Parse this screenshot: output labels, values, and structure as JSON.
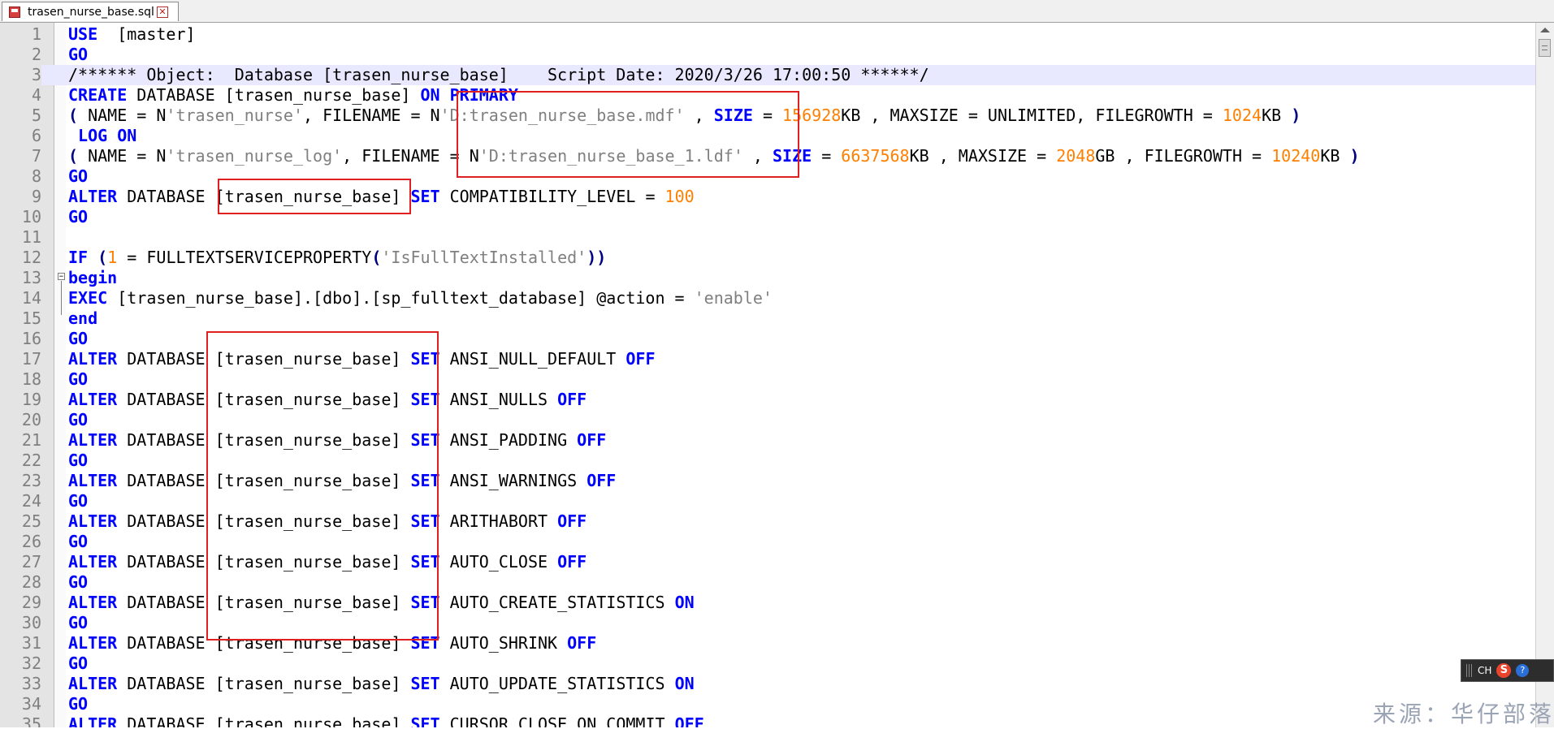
{
  "tab": {
    "label": "trasen_nurse_base.sql",
    "close_glyph": "✕",
    "icon": "sql-file-icon"
  },
  "lines": [
    {
      "n": "1",
      "t": [
        [
          "kw",
          "USE"
        ],
        [
          "",
          "  [master]"
        ]
      ]
    },
    {
      "n": "2",
      "t": [
        [
          "kw",
          "GO"
        ]
      ]
    },
    {
      "n": "3",
      "hl": true,
      "t": [
        [
          "cmt",
          "/****** Object:  Database [trasen_nurse_base]    Script Date: 2020/3/26 17:00:50 ******/"
        ]
      ]
    },
    {
      "n": "4",
      "t": [
        [
          "kw",
          "CREATE"
        ],
        [
          "",
          " DATABASE [trasen_nurse_base] "
        ],
        [
          "kw",
          "ON"
        ],
        [
          "",
          " "
        ],
        [
          "kw",
          "PRIMARY"
        ]
      ]
    },
    {
      "n": "5",
      "t": [
        [
          "op",
          "("
        ],
        [
          "",
          " NAME = N"
        ],
        [
          "str",
          "'trasen_nurse'"
        ],
        [
          "",
          ", FILENAME = N"
        ],
        [
          "str",
          "'D:trasen_nurse_base.mdf'"
        ],
        [
          "",
          " , "
        ],
        [
          "kw",
          "SIZE"
        ],
        [
          "",
          " = "
        ],
        [
          "num",
          "156928"
        ],
        [
          "",
          "KB , MAXSIZE = UNLIMITED, FILEGROWTH = "
        ],
        [
          "num",
          "1024"
        ],
        [
          "",
          "KB "
        ],
        [
          "op",
          ")"
        ]
      ]
    },
    {
      "n": "6",
      "t": [
        [
          "",
          " "
        ],
        [
          "kw",
          "LOG ON"
        ]
      ]
    },
    {
      "n": "7",
      "t": [
        [
          "op",
          "("
        ],
        [
          "",
          " NAME = N"
        ],
        [
          "str",
          "'trasen_nurse_log'"
        ],
        [
          "",
          ", FILENAME = N"
        ],
        [
          "str",
          "'D:trasen_nurse_base_1.ldf'"
        ],
        [
          "",
          " , "
        ],
        [
          "kw",
          "SIZE"
        ],
        [
          "",
          " = "
        ],
        [
          "num",
          "6637568"
        ],
        [
          "",
          "KB , MAXSIZE = "
        ],
        [
          "num",
          "2048"
        ],
        [
          "",
          "GB , FILEGROWTH = "
        ],
        [
          "num",
          "10240"
        ],
        [
          "",
          "KB "
        ],
        [
          "op",
          ")"
        ]
      ]
    },
    {
      "n": "8",
      "t": [
        [
          "kw",
          "GO"
        ]
      ]
    },
    {
      "n": "9",
      "t": [
        [
          "kw",
          "ALTER"
        ],
        [
          "",
          " DATABASE [trasen_nurse_base] "
        ],
        [
          "kw",
          "SET"
        ],
        [
          "",
          " COMPATIBILITY_LEVEL = "
        ],
        [
          "num",
          "100"
        ]
      ]
    },
    {
      "n": "10",
      "t": [
        [
          "kw",
          "GO"
        ]
      ]
    },
    {
      "n": "11",
      "t": []
    },
    {
      "n": "12",
      "t": [
        [
          "kw",
          "IF"
        ],
        [
          "",
          " "
        ],
        [
          "op",
          "("
        ],
        [
          "num",
          "1"
        ],
        [
          "",
          " = FULLTEXTSERVICEPROPERTY"
        ],
        [
          "op",
          "("
        ],
        [
          "str",
          "'IsFullTextInstalled'"
        ],
        [
          "op",
          "))"
        ]
      ]
    },
    {
      "n": "13",
      "t": [
        [
          "kw",
          "begin"
        ]
      ]
    },
    {
      "n": "14",
      "t": [
        [
          "kw",
          "EXEC"
        ],
        [
          "",
          " [trasen_nurse_base].[dbo].[sp_fulltext_database] @action = "
        ],
        [
          "str",
          "'enable'"
        ]
      ]
    },
    {
      "n": "15",
      "t": [
        [
          "kw",
          "end"
        ]
      ]
    },
    {
      "n": "16",
      "t": [
        [
          "kw",
          "GO"
        ]
      ]
    },
    {
      "n": "17",
      "t": [
        [
          "kw",
          "ALTER"
        ],
        [
          "",
          " DATABASE [trasen_nurse_base] "
        ],
        [
          "kw",
          "SET"
        ],
        [
          "",
          " ANSI_NULL_DEFAULT "
        ],
        [
          "kw",
          "OFF"
        ]
      ]
    },
    {
      "n": "18",
      "t": [
        [
          "kw",
          "GO"
        ]
      ]
    },
    {
      "n": "19",
      "t": [
        [
          "kw",
          "ALTER"
        ],
        [
          "",
          " DATABASE [trasen_nurse_base] "
        ],
        [
          "kw",
          "SET"
        ],
        [
          "",
          " ANSI_NULLS "
        ],
        [
          "kw",
          "OFF"
        ]
      ]
    },
    {
      "n": "20",
      "t": [
        [
          "kw",
          "GO"
        ]
      ]
    },
    {
      "n": "21",
      "t": [
        [
          "kw",
          "ALTER"
        ],
        [
          "",
          " DATABASE [trasen_nurse_base] "
        ],
        [
          "kw",
          "SET"
        ],
        [
          "",
          " ANSI_PADDING "
        ],
        [
          "kw",
          "OFF"
        ]
      ]
    },
    {
      "n": "22",
      "t": [
        [
          "kw",
          "GO"
        ]
      ]
    },
    {
      "n": "23",
      "t": [
        [
          "kw",
          "ALTER"
        ],
        [
          "",
          " DATABASE [trasen_nurse_base] "
        ],
        [
          "kw",
          "SET"
        ],
        [
          "",
          " ANSI_WARNINGS "
        ],
        [
          "kw",
          "OFF"
        ]
      ]
    },
    {
      "n": "24",
      "t": [
        [
          "kw",
          "GO"
        ]
      ]
    },
    {
      "n": "25",
      "t": [
        [
          "kw",
          "ALTER"
        ],
        [
          "",
          " DATABASE [trasen_nurse_base] "
        ],
        [
          "kw",
          "SET"
        ],
        [
          "",
          " ARITHABORT "
        ],
        [
          "kw",
          "OFF"
        ]
      ]
    },
    {
      "n": "26",
      "t": [
        [
          "kw",
          "GO"
        ]
      ]
    },
    {
      "n": "27",
      "t": [
        [
          "kw",
          "ALTER"
        ],
        [
          "",
          " DATABASE [trasen_nurse_base] "
        ],
        [
          "kw",
          "SET"
        ],
        [
          "",
          " AUTO_CLOSE "
        ],
        [
          "kw",
          "OFF"
        ]
      ]
    },
    {
      "n": "28",
      "t": [
        [
          "kw",
          "GO"
        ]
      ]
    },
    {
      "n": "29",
      "t": [
        [
          "kw",
          "ALTER"
        ],
        [
          "",
          " DATABASE [trasen_nurse_base] "
        ],
        [
          "kw",
          "SET"
        ],
        [
          "",
          " AUTO_CREATE_STATISTICS "
        ],
        [
          "kw",
          "ON"
        ]
      ]
    },
    {
      "n": "30",
      "t": [
        [
          "kw",
          "GO"
        ]
      ]
    },
    {
      "n": "31",
      "t": [
        [
          "kw",
          "ALTER"
        ],
        [
          "",
          " DATABASE [trasen_nurse_base] "
        ],
        [
          "kw",
          "SET"
        ],
        [
          "",
          " AUTO_SHRINK "
        ],
        [
          "kw",
          "OFF"
        ]
      ]
    },
    {
      "n": "32",
      "t": [
        [
          "kw",
          "GO"
        ]
      ]
    },
    {
      "n": "33",
      "t": [
        [
          "kw",
          "ALTER"
        ],
        [
          "",
          " DATABASE [trasen_nurse_base] "
        ],
        [
          "kw",
          "SET"
        ],
        [
          "",
          " AUTO_UPDATE_STATISTICS "
        ],
        [
          "kw",
          "ON"
        ]
      ]
    },
    {
      "n": "34",
      "t": [
        [
          "kw",
          "GO"
        ]
      ]
    },
    {
      "n": "35",
      "t": [
        [
          "kw",
          "ALTER"
        ],
        [
          "",
          " DATABASE [trasen_nurse_base] "
        ],
        [
          "kw",
          "SET"
        ],
        [
          "",
          " CURSOR_CLOSE_ON_COMMIT "
        ],
        [
          "kw",
          "OFF"
        ]
      ]
    }
  ],
  "ime": {
    "lang": "CH",
    "logo": "S",
    "help": "?"
  },
  "watermark": "来源：华仔部落",
  "colors": {
    "keyword": "#0000ff",
    "number": "#ff8000",
    "string": "#808080",
    "annotation": "#e02020",
    "highlight_line": "#e8e8ff"
  }
}
